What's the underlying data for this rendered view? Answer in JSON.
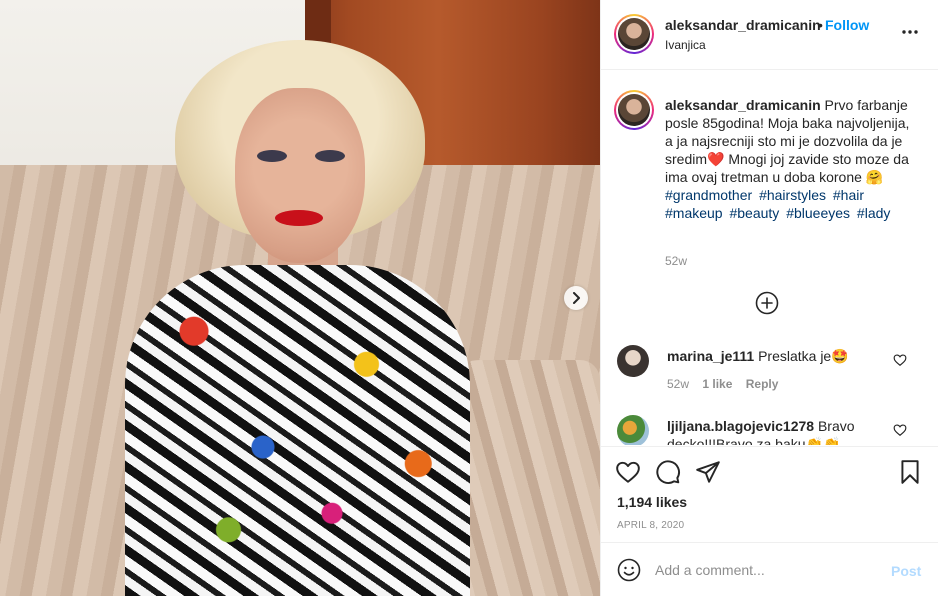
{
  "post": {
    "username": "aleksandar_dramicanin",
    "follow_separator": "•",
    "follow_label": "Follow",
    "location": "Ivanjica",
    "more_icon": "more-horizontal-icon"
  },
  "caption": {
    "username": "aleksandar_dramicanin",
    "text_part1": "Prvo farbanje posle 85godina! Moja baka najvoljenija, a ja najsrecniji sto mi je dozvolila da je sredim",
    "heart_emoji": "❤️",
    "text_part2": " Mnogi joj zavide sto moze da ima ovaj tretman u doba korone ",
    "smile_emoji": "🤗",
    "hashtags": [
      "#grandmother",
      "#hairstyles",
      "#hair",
      "#makeup",
      "#beauty",
      "#blueeyes",
      "#lady"
    ],
    "time": "52w"
  },
  "comments": [
    {
      "username": "marina_je111",
      "text": "Preslatka je🤩",
      "time": "52w",
      "likes": "1 like",
      "reply": "Reply"
    },
    {
      "username": "ljiljana.blagojevic1278",
      "text": "Bravo decko!!!Bravo za baku👏👏",
      "time": "",
      "likes": "",
      "reply": ""
    }
  ],
  "stats": {
    "likes": "1,194 likes",
    "date": "APRIL 8, 2020"
  },
  "add_comment": {
    "placeholder": "Add a comment...",
    "post_label": "Post"
  },
  "colors": {
    "link_blue": "#0095f6",
    "hashtag": "#00376b",
    "muted": "#8e8e8e",
    "post_disabled": "#b3dbff",
    "heart_red": "#ed4956"
  }
}
